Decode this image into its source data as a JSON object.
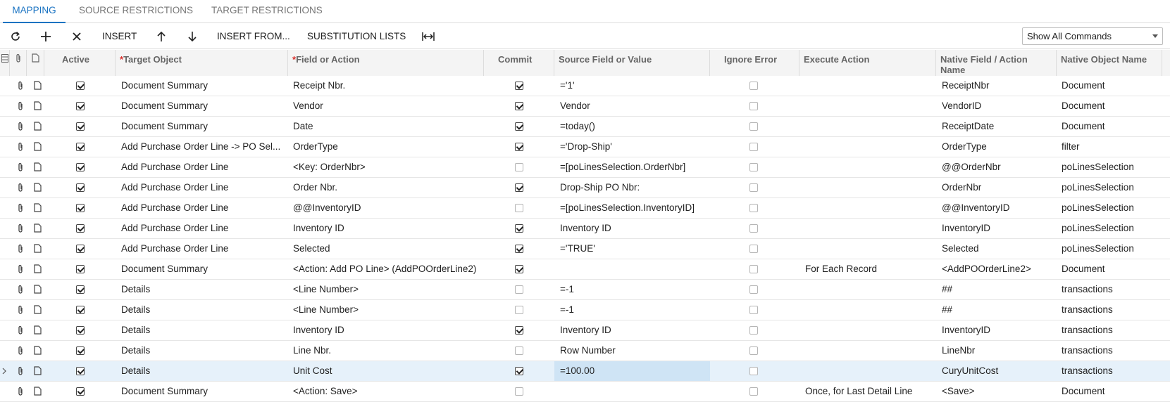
{
  "tabs": [
    {
      "label": "MAPPING",
      "active": true
    },
    {
      "label": "SOURCE RESTRICTIONS",
      "active": false
    },
    {
      "label": "TARGET RESTRICTIONS",
      "active": false
    }
  ],
  "toolbar": {
    "refresh_icon": "refresh-icon",
    "add_icon": "plus-icon",
    "delete_icon": "close-icon",
    "insert_label": "INSERT",
    "move_up_icon": "arrow-up-icon",
    "move_down_icon": "arrow-down-icon",
    "insert_from_label": "INSERT FROM...",
    "substitution_lists_label": "SUBSTITUTION LISTS",
    "fit_columns_icon": "fit-width-icon",
    "commands_select_value": "Show All Commands"
  },
  "columns": {
    "active": "Active",
    "target_object": "Target Object",
    "field_or_action": "Field or Action",
    "commit": "Commit",
    "source_field": "Source Field or Value",
    "ignore_error": "Ignore Error",
    "execute_action": "Execute Action",
    "native_field_line1": "Native Field / Action",
    "native_field_line2": "Name",
    "native_object": "Native Object Name"
  },
  "rows": [
    {
      "active": true,
      "target": "Document Summary",
      "field": "Receipt Nbr.",
      "commit": true,
      "source": "='1'",
      "ignore": false,
      "execute": "",
      "native_field": "ReceiptNbr",
      "native_object": "Document"
    },
    {
      "active": true,
      "target": "Document Summary",
      "field": "Vendor",
      "commit": true,
      "source": "Vendor",
      "ignore": false,
      "execute": "",
      "native_field": "VendorID",
      "native_object": "Document"
    },
    {
      "active": true,
      "target": "Document Summary",
      "field": "Date",
      "commit": true,
      "source": "=today()",
      "ignore": false,
      "execute": "",
      "native_field": "ReceiptDate",
      "native_object": "Document"
    },
    {
      "active": true,
      "target": "Add Purchase Order Line -> PO Sel...",
      "field": "OrderType",
      "commit": true,
      "source": "='Drop-Ship'",
      "ignore": false,
      "execute": "",
      "native_field": "OrderType",
      "native_object": "filter"
    },
    {
      "active": true,
      "target": "Add Purchase Order Line",
      "field": "<Key: OrderNbr>",
      "commit": false,
      "source": "=[poLinesSelection.OrderNbr]",
      "ignore": false,
      "execute": "",
      "native_field": "@@OrderNbr",
      "native_object": "poLinesSelection"
    },
    {
      "active": true,
      "target": "Add Purchase Order Line",
      "field": "Order Nbr.",
      "commit": true,
      "source": "Drop-Ship PO Nbr:",
      "ignore": false,
      "execute": "",
      "native_field": "OrderNbr",
      "native_object": "poLinesSelection"
    },
    {
      "active": true,
      "target": "Add Purchase Order Line",
      "field": "@@InventoryID",
      "commit": false,
      "source": "=[poLinesSelection.InventoryID]",
      "ignore": false,
      "execute": "",
      "native_field": "@@InventoryID",
      "native_object": "poLinesSelection"
    },
    {
      "active": true,
      "target": "Add Purchase Order Line",
      "field": "Inventory ID",
      "commit": true,
      "source": "Inventory ID",
      "ignore": false,
      "execute": "",
      "native_field": "InventoryID",
      "native_object": "poLinesSelection"
    },
    {
      "active": true,
      "target": "Add Purchase Order Line",
      "field": "Selected",
      "commit": true,
      "source": "='TRUE'",
      "ignore": false,
      "execute": "",
      "native_field": "Selected",
      "native_object": "poLinesSelection"
    },
    {
      "active": true,
      "target": "Document Summary",
      "field": "<Action: Add PO Line> (AddPOOrderLine2)",
      "commit": true,
      "source": "",
      "ignore": false,
      "execute": "For Each Record",
      "native_field": "<AddPOOrderLine2>",
      "native_object": "Document"
    },
    {
      "active": true,
      "target": "Details",
      "field": "<Line Number>",
      "commit": false,
      "source": "=-1",
      "ignore": false,
      "execute": "",
      "native_field": "##",
      "native_object": "transactions"
    },
    {
      "active": true,
      "target": "Details",
      "field": "<Line Number>",
      "commit": false,
      "source": "=-1",
      "ignore": false,
      "execute": "",
      "native_field": "##",
      "native_object": "transactions"
    },
    {
      "active": true,
      "target": "Details",
      "field": "Inventory ID",
      "commit": true,
      "source": "Inventory ID",
      "ignore": false,
      "execute": "",
      "native_field": "InventoryID",
      "native_object": "transactions"
    },
    {
      "active": true,
      "target": "Details",
      "field": "Line Nbr.",
      "commit": false,
      "source": "Row Number",
      "ignore": false,
      "execute": "",
      "native_field": "LineNbr",
      "native_object": "transactions"
    },
    {
      "active": true,
      "target": "Details",
      "field": "Unit Cost",
      "commit": true,
      "source": "=100.00",
      "ignore": false,
      "execute": "",
      "native_field": "CuryUnitCost",
      "native_object": "transactions",
      "selected": true
    },
    {
      "active": true,
      "target": "Document Summary",
      "field": "<Action: Save>",
      "commit": false,
      "source": "",
      "ignore": false,
      "execute": "Once, for Last Detail Line",
      "native_field": "<Save>",
      "native_object": "Document"
    }
  ],
  "colors": {
    "accent": "#1a73c2",
    "selected_row": "#e6f1fa",
    "selected_cell": "#cfe4f5",
    "required_marker": "#d9302c"
  }
}
